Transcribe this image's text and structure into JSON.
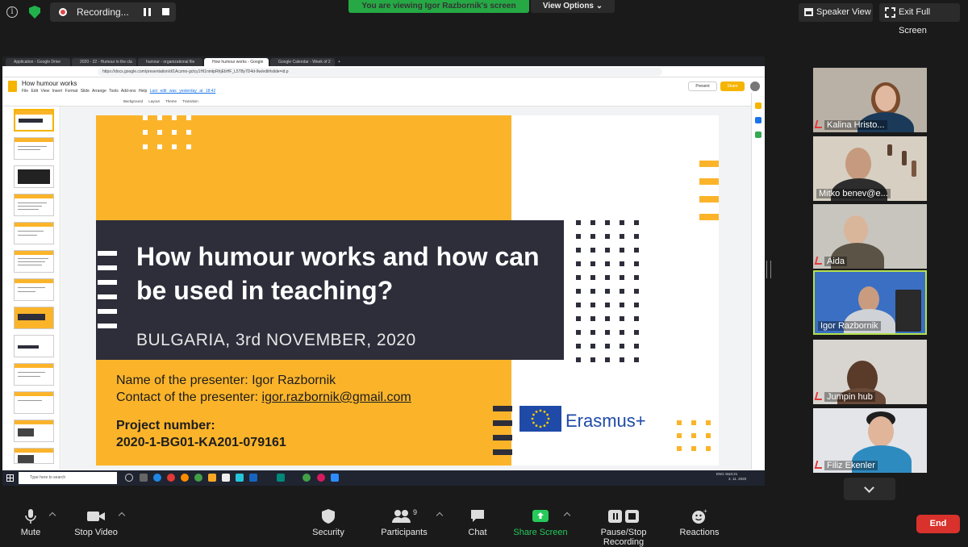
{
  "top_bar": {
    "recording_label": "Recording...",
    "viewing_banner": "You are viewing Igor Razbornik's screen",
    "view_options": "View Options",
    "speaker_view": "Speaker View",
    "exit_full_screen": "Exit Full Screen"
  },
  "browser": {
    "tabs": [
      "Application - Google Drive",
      "2020 - 22 - Humour in the cla",
      "humour - organizational file",
      "How humour works - Google",
      "Google Calendar - Week of 2"
    ],
    "url": "https://docs.google.com/presentation/d/1Aczmo-gctcy1Hi1nmtpRhjEbHF_L5T8y7D4d-9w/edit#slide=id.p"
  },
  "slides_app": {
    "doc_title": "How humour works",
    "menus": [
      "File",
      "Edit",
      "View",
      "Insert",
      "Format",
      "Slide",
      "Arrange",
      "Tools",
      "Add-ons",
      "Help"
    ],
    "last_edit": "Last edit was yesterday at 18:42",
    "present_label": "Present",
    "share_label": "Share",
    "toolbar_items": [
      "Background",
      "Layout",
      "Theme",
      "Transition"
    ]
  },
  "slide": {
    "title": "How humour works and how can be used in teaching?",
    "subtitle": "BULGARIA, 3rd NOVEMBER, 2020",
    "presenter_name": "Name of the presenter: Igor Razbornik",
    "contact_prefix": "Contact of the presenter: ",
    "contact_email": "igor.razbornik@gmail.com",
    "project_label": "Project number:",
    "project_number": "2020-1-BG01-KA201-079161",
    "logo_text": "Erasmus+"
  },
  "taskbar": {
    "search_placeholder": "Type here to search",
    "tray_lang": "ENG SL",
    "time": "10:21",
    "date": "3. 11. 2020"
  },
  "participants": [
    {
      "name": "Kalina Hristo...",
      "muted": true
    },
    {
      "name": "Mitko benev@e...",
      "muted": false
    },
    {
      "name": "Aida",
      "muted": true
    },
    {
      "name": "Igor Razbornik",
      "muted": false,
      "active": true
    },
    {
      "name": "Jumpin hub",
      "muted": true
    },
    {
      "name": "Filiz Ekenler",
      "muted": true
    }
  ],
  "controls": {
    "mute": "Mute",
    "stop_video": "Stop Video",
    "security": "Security",
    "participants": "Participants",
    "participants_count": "9",
    "chat": "Chat",
    "share_screen": "Share Screen",
    "pause_stop_recording": "Pause/Stop Recording",
    "reactions": "Reactions",
    "end": "End"
  },
  "colors": {
    "slide_yellow": "#fbb42a",
    "slide_dark": "#2d2e3a",
    "zoom_green": "#26a845",
    "end_red": "#d9312b",
    "active_speaker": "#b4e04c"
  }
}
